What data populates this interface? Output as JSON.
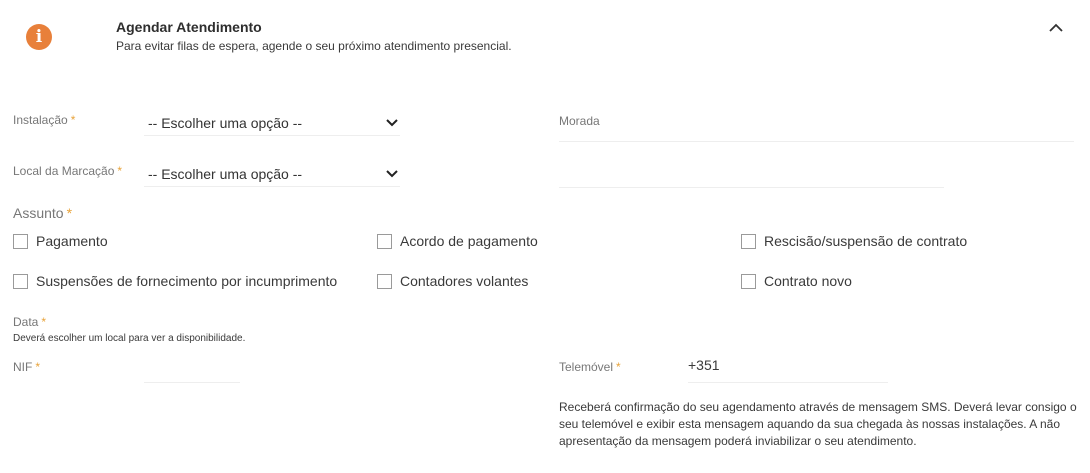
{
  "header": {
    "icon": "info-icon",
    "info_glyph": "i",
    "title": "Agendar Atendimento",
    "subtitle": "Para evitar filas de espera, agende o seu próximo atendimento presencial.",
    "collapse_icon": "chevron-up-icon"
  },
  "required_marker": "*",
  "accent_color": "#e8803a",
  "instalacao": {
    "label": "Instalação",
    "value": "-- Escolher uma opção --"
  },
  "local": {
    "label": "Local da Marcação",
    "value": "-- Escolher uma opção --"
  },
  "morada": {
    "label": "Morada",
    "value": ""
  },
  "assunto": {
    "label": "Assunto",
    "options": [
      "Pagamento",
      "Acordo de pagamento",
      "Rescisão/suspensão de contrato",
      "Suspensões de fornecimento por incumprimento",
      "Contadores volantes",
      "Contrato novo"
    ]
  },
  "data_field": {
    "label": "Data",
    "note": "Deverá escolher um local para ver a disponibilidade."
  },
  "nif": {
    "label": "NIF",
    "value": ""
  },
  "telemovel": {
    "label": "Telemóvel",
    "prefix": "+351",
    "value": "",
    "note": "Receberá confirmação do seu agendamento através de mensagem SMS. Deverá levar consigo o seu telemóvel e exibir esta mensagem aquando da sua chegada às nossas instalações. A não apresentação da mensagem poderá inviabilizar o seu atendimento."
  }
}
